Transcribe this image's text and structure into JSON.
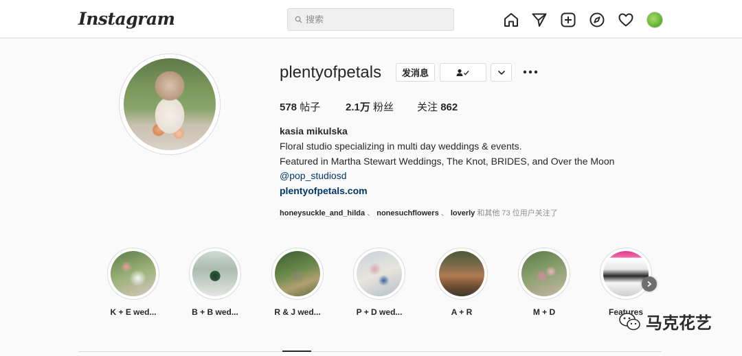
{
  "app": {
    "logo_text": "Instagram"
  },
  "search": {
    "placeholder": "搜索"
  },
  "nav": {
    "icons": [
      "home-icon",
      "direct-send-icon",
      "new-post-icon",
      "explore-compass-icon",
      "activity-heart-icon"
    ],
    "avatar": "current-user-avatar"
  },
  "profile": {
    "username": "plentyofpetals",
    "message_button": "发消息",
    "posts_count": "578",
    "posts_label": "帖子",
    "followers_count": "2.1万",
    "followers_label": "粉丝",
    "following_label": "关注",
    "following_count": "862",
    "full_name": "kasia mikulska",
    "bio_line1": "Floral studio specializing in multi day weddings & events.",
    "bio_line2": "Featured in Martha Stewart Weddings, The Knot, BRIDES, and Over the Moon",
    "mention": "@pop_studiosd",
    "website": "plentyofpetals.com",
    "followed_by_1": "honeysuckle_and_hilda",
    "followed_by_sep1": "、",
    "followed_by_2": "nonesuchflowers",
    "followed_by_sep2": "、",
    "followed_by_3": "loverly",
    "followed_by_suffix": "和其他 73 位用户关注了"
  },
  "highlights": [
    {
      "label": "K + E wed..."
    },
    {
      "label": "B + B wed..."
    },
    {
      "label": "R & J wed..."
    },
    {
      "label": "P + D wed..."
    },
    {
      "label": "A + R"
    },
    {
      "label": "M + D"
    },
    {
      "label": "Features"
    }
  ],
  "watermark": {
    "text": "马克花艺"
  },
  "colors": {
    "link": "#00376b",
    "border": "#dbdbdb",
    "text": "#262626",
    "muted": "#8e8e8e"
  }
}
